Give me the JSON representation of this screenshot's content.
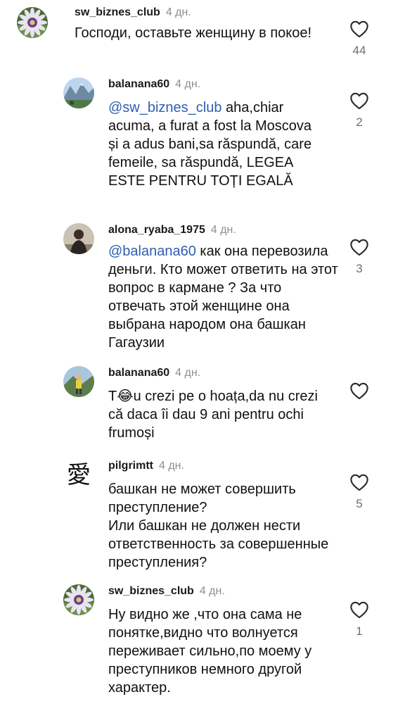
{
  "comments": [
    {
      "username": "sw_biznes_club",
      "time": "4 дн.",
      "mention": "",
      "text": "Господи, оставьте женщину в покое!",
      "likes": "44",
      "avatar": "flower-avatar"
    },
    {
      "username": "balanana60",
      "time": "4 дн.",
      "mention": "@sw_biznes_club",
      "text": " aha,chiar acuma, a furat  a fost la Moscova și a adus bani,sa răspundă, care femeile, sa răspundă, LEGEA ESTE PENTRU TOȚI EGALĂ",
      "likes": "2",
      "avatar": "mountain-avatar"
    },
    {
      "username": "alona_ryaba_1975",
      "time": "4 дн.",
      "mention": "@balanana60",
      "text": " как она перевозила деньги. Кто может ответить на этот вопрос в кармане ?  За что отвечать этой женщине  она выбрана народом она  башкан Гагаузии",
      "likes": "3",
      "avatar": "person-avatar"
    },
    {
      "username": "balanana60",
      "time": "4 дн.",
      "mention": "",
      "text": "T😂u crezi pe o hoața,da nu crezi că daca îi dau 9 ani pentru ochi frumoși",
      "likes": "",
      "avatar": "hiker-avatar"
    },
    {
      "username": "pilgrimtt",
      "time": "4 дн.",
      "mention": "",
      "text": "башкан не может совершить преступление?\nИли башкан не должен нести ответственность за совершенные преступления?",
      "likes": "5",
      "avatar": "kanji-avatar",
      "avatar_glyph": "愛"
    },
    {
      "username": "sw_biznes_club",
      "time": "4 дн.",
      "mention": "",
      "text": "Ну видно же ,что она сама не понятке,видно что волнуется переживает сильно,по моему  у преступников немного другой характер.",
      "likes": "1",
      "avatar": "flower-avatar"
    }
  ],
  "colors": {
    "text": "#111111",
    "meta": "#8e8e8e",
    "mention": "#2f5eb0",
    "like_count": "#6f6f6f"
  }
}
